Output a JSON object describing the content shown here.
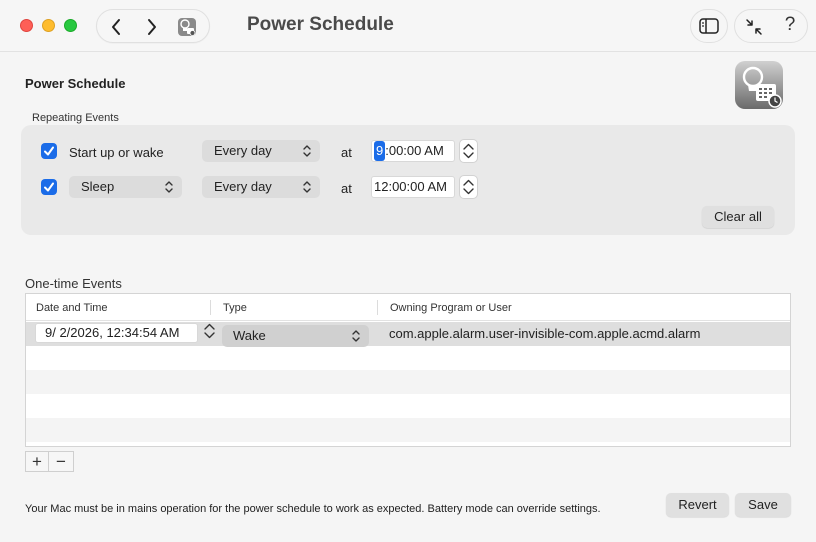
{
  "window": {
    "title": "Power Schedule"
  },
  "toolbar": {
    "back_icon": "chevron-left-icon",
    "forward_icon": "chevron-right-icon",
    "app_icon": "power-schedule-app-icon",
    "sidebar_icon": "sidebar-toggle-icon",
    "collapse_icon": "collapse-arrows-icon",
    "help_label": "?"
  },
  "section": {
    "title": "Power Schedule"
  },
  "repeating": {
    "label": "Repeating Events",
    "rows": [
      {
        "checked": true,
        "event": "Start up or wake",
        "frequency": "Every day",
        "at": "at",
        "time_hour": "9",
        "time_rest": ":00:00 AM"
      },
      {
        "checked": true,
        "event": "Sleep",
        "frequency": "Every day",
        "at": "at",
        "time": "12:00:00 AM"
      }
    ],
    "clear_all": "Clear all"
  },
  "onetime": {
    "label": "One-time Events",
    "columns": [
      "Date and Time",
      "Type",
      "Owning Program or User"
    ],
    "rows": [
      {
        "datetime": "9/  2/2026, 12:34:54 AM",
        "type": "Wake",
        "owner": "com.apple.alarm.user-invisible-com.apple.acmd.alarm"
      }
    ],
    "add_label": "+",
    "remove_label": "−"
  },
  "footer": {
    "note": "Your Mac must be in mains operation for the power schedule to work as expected. Battery mode can override settings.",
    "revert": "Revert",
    "save": "Save"
  },
  "colors": {
    "accent": "#1b6ce8",
    "close": "#fe5f57",
    "minimize": "#febc2e",
    "zoom": "#28c840"
  }
}
